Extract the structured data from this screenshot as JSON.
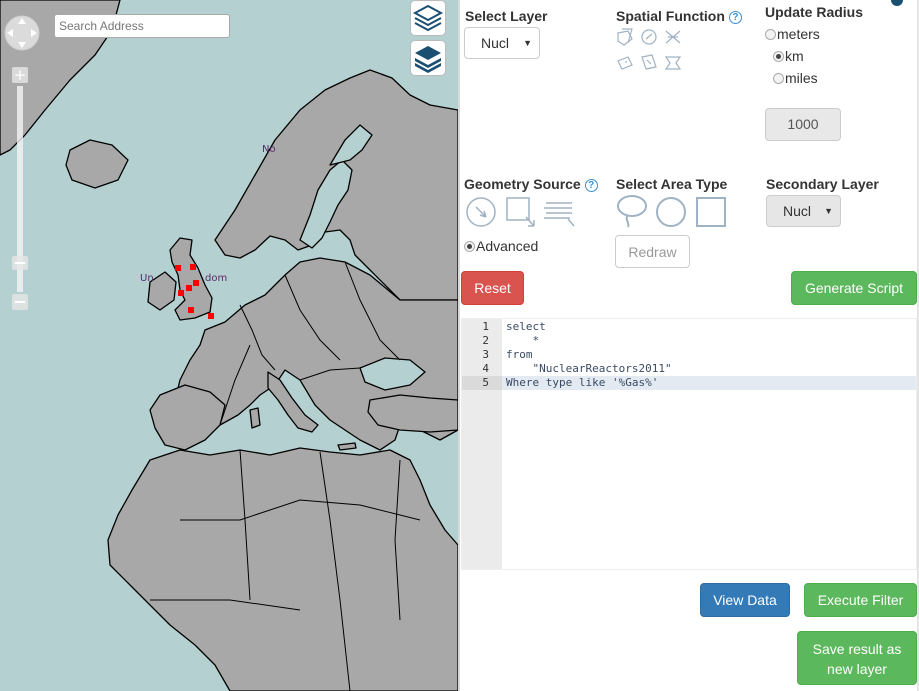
{
  "map": {
    "search": {
      "placeholder": "Search Address"
    },
    "labels": {
      "uk_left": "Un",
      "uk_right": "dom",
      "norway": "No"
    }
  },
  "panel": {
    "select_layer": {
      "title": "Select Layer",
      "value": "Nucl"
    },
    "spatial_function": {
      "title": "Spatial Function",
      "help": "?"
    },
    "update_radius": {
      "title": "Update Radius",
      "units": [
        {
          "label": "meters",
          "selected": false
        },
        {
          "label": "km",
          "selected": true
        },
        {
          "label": "miles",
          "selected": false
        }
      ],
      "value": "1000"
    },
    "geometry_source": {
      "title": "Geometry Source",
      "help": "?",
      "advanced_label": "Advanced"
    },
    "select_area_type": {
      "title": "Select Area Type",
      "redraw_label": "Redraw"
    },
    "secondary_layer": {
      "title": "Secondary Layer",
      "value": "Nucl"
    },
    "reset_label": "Reset",
    "generate_label": "Generate Script",
    "code": [
      {
        "n": "1",
        "text": "select"
      },
      {
        "n": "2",
        "text": "    *"
      },
      {
        "n": "3",
        "text": "from"
      },
      {
        "n": "4",
        "text": "    \"NuclearReactors2011\""
      },
      {
        "n": "5",
        "text": "Where type like '%Gas%'"
      }
    ],
    "view_data_label": "View Data",
    "execute_label": "Execute Filter",
    "save_label_1": "Save result as",
    "save_label_2": "new layer"
  },
  "colors": {
    "water": "#b5d0d0",
    "land": "#a8a8a8",
    "marker": "#ff0000"
  }
}
